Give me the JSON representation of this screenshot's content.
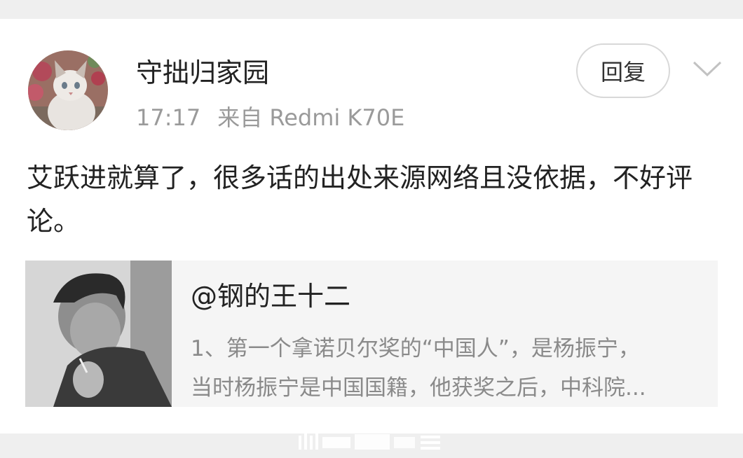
{
  "post": {
    "username": "守拙归家园",
    "time": "17:17",
    "source": "来自 Redmi K70E",
    "reply_label": "回复",
    "content": "艾跃进就算了，很多话的出处来源网络且没依据，不好评论。"
  },
  "quote": {
    "author": "@钢的王十二",
    "line1": "1、第一个拿诺贝尔奖的“中国人”，是杨振宁，",
    "line2": "当时杨振宁是中国国籍，他获奖之后，中科院..."
  },
  "icons": {
    "more": "chevron-down-icon"
  }
}
